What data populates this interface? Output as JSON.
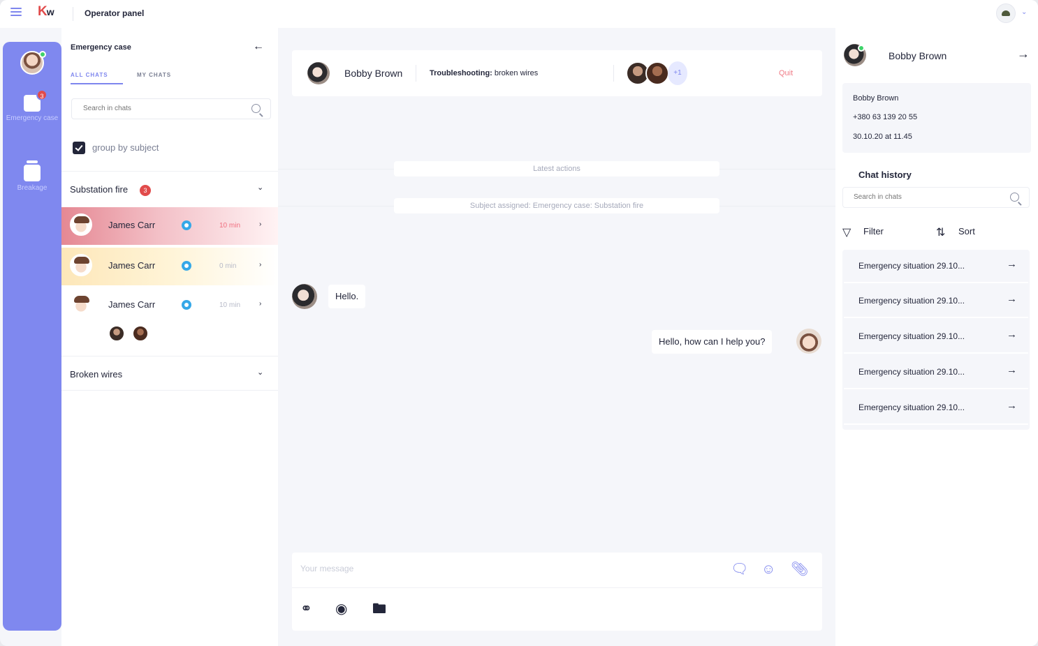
{
  "app": {
    "title": "Operator panel"
  },
  "rail": {
    "items": [
      {
        "label": "Emergency case",
        "badge": "3"
      },
      {
        "label": "Breakage"
      }
    ]
  },
  "chat_list": {
    "title": "Emergency case",
    "tabs": [
      "ALL CHATS",
      "MY CHATS"
    ],
    "search_placeholder": "Search in chats",
    "group_by_label": "group by subject",
    "groups": [
      {
        "name": "Substation fire",
        "badge": "3"
      },
      {
        "name": "Broken wires"
      }
    ],
    "chats": [
      {
        "name": "James Carr",
        "time": "10 min",
        "status": "urgent"
      },
      {
        "name": "James Carr",
        "time": "0 min",
        "status": "pending"
      },
      {
        "name": "James Carr",
        "time": "10 min",
        "status": "normal"
      }
    ]
  },
  "conversation": {
    "contact_name": "Bobby Brown",
    "subject_label": "Troubleshooting:",
    "subject_value": "broken wires",
    "extra_participants": "+1",
    "quit_label": "Quit",
    "system_messages": [
      "Latest actions",
      "Subject assigned: Emergency case: Substation fire"
    ],
    "messages": [
      {
        "from": "contact",
        "text": "Hello."
      },
      {
        "from": "operator",
        "text": "Hello, how can I help you?"
      }
    ],
    "composer_placeholder": "Your message"
  },
  "profile": {
    "name": "Bobby Brown",
    "info": {
      "name": "Bobby Brown",
      "phone": "+380 63 139 20 55",
      "date": "30.10.20 at 11.45"
    },
    "history_title": "Chat history",
    "history_search_placeholder": "Search in chats",
    "filter_label": "Filter",
    "sort_label": "Sort",
    "history": [
      "Emergency situation 29.10...",
      "Emergency situation 29.10...",
      "Emergency situation 29.10...",
      "Emergency situation 29.10...",
      "Emergency situation 29.10..."
    ]
  },
  "colors": {
    "accent": "#7e86ee",
    "urgent": "#e14b4b",
    "online": "#3ed36a"
  }
}
